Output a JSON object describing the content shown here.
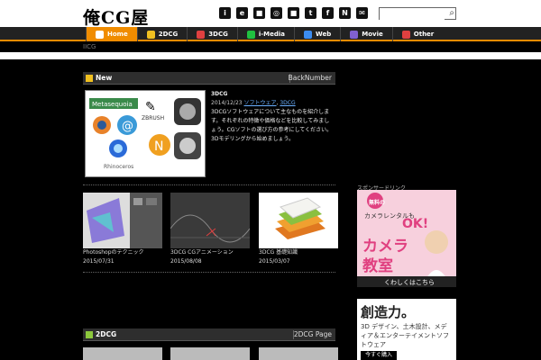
{
  "header": {
    "logo": "俺CG屋",
    "social_icons": [
      "i",
      "e",
      "■",
      "◎",
      "■",
      "t",
      "f",
      "N",
      "✉"
    ],
    "search_placeholder": ""
  },
  "nav": {
    "items": [
      {
        "label": "Home",
        "icon": "home-icon",
        "color": "#f08c00",
        "active": true
      },
      {
        "label": "2DCG",
        "icon": "pencil-icon",
        "color": "#f0c020",
        "active": false
      },
      {
        "label": "3DCG",
        "icon": "cube-icon",
        "color": "#e04040",
        "active": false
      },
      {
        "label": "i-Media",
        "icon": "media-icon",
        "color": "#20c040",
        "active": false
      },
      {
        "label": "Web",
        "icon": "globe-icon",
        "color": "#3c8cf0",
        "active": false
      },
      {
        "label": "Movie",
        "icon": "film-icon",
        "color": "#8060d0",
        "active": false
      },
      {
        "label": "Other",
        "icon": "plus-icon",
        "color": "#e04040",
        "active": false
      }
    ]
  },
  "breadcrumb": "IICG",
  "new_section": {
    "title": "New",
    "link": "BackNumber",
    "feature": {
      "title": "3DCG",
      "date": "2014/12/23",
      "cats": [
        "ソフトウェア",
        "3DCG"
      ],
      "body": "3DCGソフトウェアについて主なものを紹介します。それぞれの特徴や価格などを比較してみましょう。CGソフトの選び方の参考にしてください。3Dモデリングから始めましょう。"
    },
    "items": [
      {
        "caption": "Photoshopのテクニック",
        "date": "2015/07/31"
      },
      {
        "caption": "3DCG CGアニメーション",
        "date": "2015/08/08"
      },
      {
        "caption": "3DCG 基礎知識",
        "date": "2015/03/07"
      }
    ]
  },
  "twodcg_section": {
    "title": "2DCG",
    "link": "2DCG Page"
  },
  "sidebar": {
    "label": "スポンサードリンク",
    "ad1": {
      "badge": "無料の",
      "line1": "カメラレンタルも",
      "ok": "OK!",
      "main1": "カメラ",
      "main2": "教室",
      "cta": "くわしくはこちら"
    },
    "ad2": {
      "headline": "創造力。",
      "body": "3D デザイン、土木設計、メディア＆エンターテイメントソフトウェア",
      "cta": "今すぐ購入"
    }
  }
}
